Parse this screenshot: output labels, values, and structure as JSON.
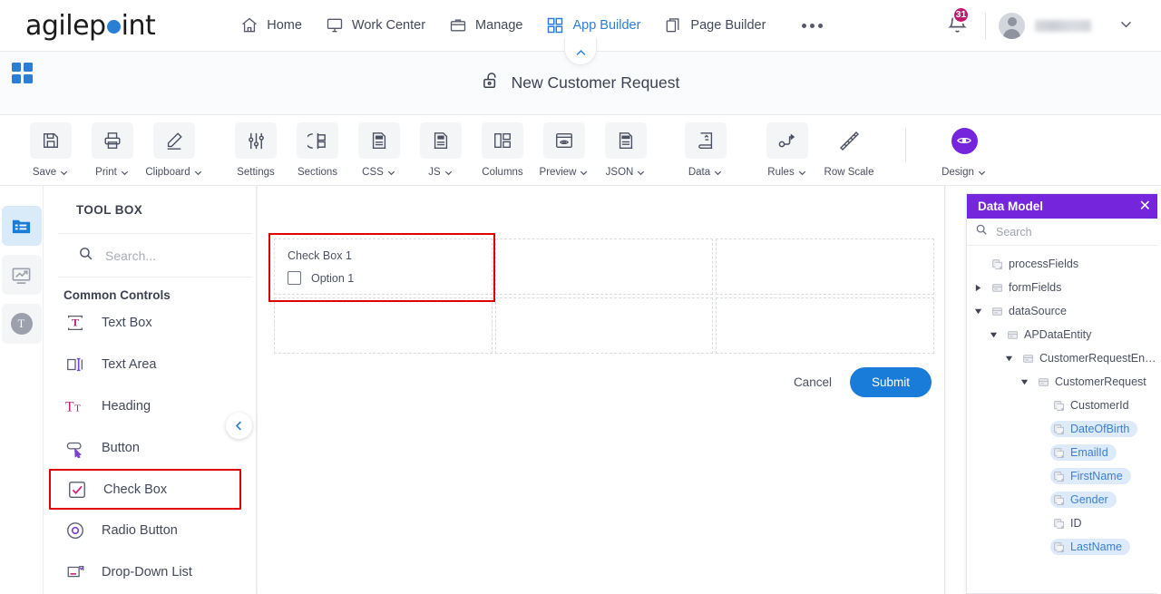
{
  "brand": {
    "name_pre": "agilep",
    "name_post": "int"
  },
  "topnav": {
    "items": [
      {
        "label": "Home",
        "icon": "home-icon",
        "active": false
      },
      {
        "label": "Work Center",
        "icon": "monitor-icon",
        "active": false
      },
      {
        "label": "Manage",
        "icon": "briefcase-icon",
        "active": false
      },
      {
        "label": "App Builder",
        "icon": "grid-icon",
        "active": true
      },
      {
        "label": "Page Builder",
        "icon": "pages-icon",
        "active": false
      }
    ],
    "more_label": "More",
    "notification_count": "31",
    "username": ""
  },
  "titlebar": {
    "title": "New Customer Request",
    "lock_icon": "unlocked-padlock-icon"
  },
  "toolbar": {
    "group1": [
      {
        "label": "Save",
        "icon": "floppy-disk-icon",
        "caret": true
      },
      {
        "label": "Print",
        "icon": "printer-icon",
        "caret": true
      },
      {
        "label": "Clipboard",
        "icon": "pencil-icon",
        "caret": true
      }
    ],
    "group2": [
      {
        "label": "Settings",
        "icon": "sliders-icon",
        "caret": false
      },
      {
        "label": "Sections",
        "icon": "sections-icon",
        "caret": false
      },
      {
        "label": "CSS",
        "icon": "css-file-icon",
        "caret": true
      },
      {
        "label": "JS",
        "icon": "js-file-icon",
        "caret": true
      },
      {
        "label": "Columns",
        "icon": "columns-icon",
        "caret": false
      },
      {
        "label": "Preview",
        "icon": "eye-window-icon",
        "caret": true
      },
      {
        "label": "JSON",
        "icon": "json-file-icon",
        "caret": true
      }
    ],
    "group3": [
      {
        "label": "Data",
        "icon": "data-book-icon",
        "caret": true
      }
    ],
    "group4": [
      {
        "label": "Rules",
        "icon": "rules-flow-icon",
        "caret": true
      },
      {
        "label": "Row Scale",
        "icon": "ruler-icon",
        "caret": false
      }
    ],
    "design": {
      "label": "Design",
      "icon": "eye-circle-icon",
      "caret": true,
      "color": "#7526dc"
    }
  },
  "rail": {
    "items": [
      {
        "name": "toolbox-rail-icon",
        "state": "active"
      },
      {
        "name": "analytics-rail-icon",
        "state": "idle"
      },
      {
        "name": "theme-rail-icon",
        "state": "idle",
        "glyph": "T"
      }
    ]
  },
  "toolbox": {
    "heading": "TOOL BOX",
    "search_placeholder": "Search...",
    "search_value": "",
    "section_title": "Common Controls",
    "items": [
      {
        "label": "Text Box",
        "icon": "textbox-icon",
        "highlighted": false
      },
      {
        "label": "Text Area",
        "icon": "textarea-icon",
        "highlighted": false
      },
      {
        "label": "Heading",
        "icon": "heading-icon",
        "highlighted": false
      },
      {
        "label": "Button",
        "icon": "button-icon",
        "highlighted": false
      },
      {
        "label": "Check Box",
        "icon": "checkbox-icon",
        "highlighted": true
      },
      {
        "label": "Radio Button",
        "icon": "radio-icon",
        "highlighted": false
      },
      {
        "label": "Drop-Down List",
        "icon": "dropdown-icon",
        "highlighted": false
      }
    ]
  },
  "canvas": {
    "checkbox_control": {
      "label": "Check Box 1",
      "option_label": "Option 1",
      "checked": false
    },
    "cancel_label": "Cancel",
    "submit_label": "Submit",
    "submit_color": "#1a7cd9",
    "selection_color": "#e00000"
  },
  "data_model": {
    "title": "Data Model",
    "search_placeholder": "Search",
    "search_value": "",
    "header_color": "#7526dc",
    "tree": [
      {
        "label": "processFields",
        "depth": 0,
        "arrow": "none",
        "icon": "field-icon",
        "pill": false
      },
      {
        "label": "formFields",
        "depth": 0,
        "arrow": "collapsed",
        "icon": "folder-icon",
        "pill": false
      },
      {
        "label": "dataSource",
        "depth": 0,
        "arrow": "expanded",
        "icon": "folder-icon",
        "pill": false
      },
      {
        "label": "APDataEntity",
        "depth": 1,
        "arrow": "expanded",
        "icon": "folder-icon",
        "pill": false
      },
      {
        "label": "CustomerRequestEn…",
        "depth": 2,
        "arrow": "expanded",
        "icon": "folder-icon",
        "pill": false
      },
      {
        "label": "CustomerRequest",
        "depth": 3,
        "arrow": "expanded",
        "icon": "folder-icon",
        "pill": false
      },
      {
        "label": "CustomerId",
        "depth": 4,
        "arrow": "none",
        "icon": "field-icon",
        "pill": false
      },
      {
        "label": "DateOfBirth",
        "depth": 4,
        "arrow": "none",
        "icon": "field-icon",
        "pill": true
      },
      {
        "label": "EmailId",
        "depth": 4,
        "arrow": "none",
        "icon": "field-icon",
        "pill": true
      },
      {
        "label": "FirstName",
        "depth": 4,
        "arrow": "none",
        "icon": "field-icon",
        "pill": true
      },
      {
        "label": "Gender",
        "depth": 4,
        "arrow": "none",
        "icon": "field-icon",
        "pill": true
      },
      {
        "label": "ID",
        "depth": 4,
        "arrow": "none",
        "icon": "field-icon",
        "pill": false
      },
      {
        "label": "LastName",
        "depth": 4,
        "arrow": "none",
        "icon": "field-icon",
        "pill": true
      }
    ]
  }
}
